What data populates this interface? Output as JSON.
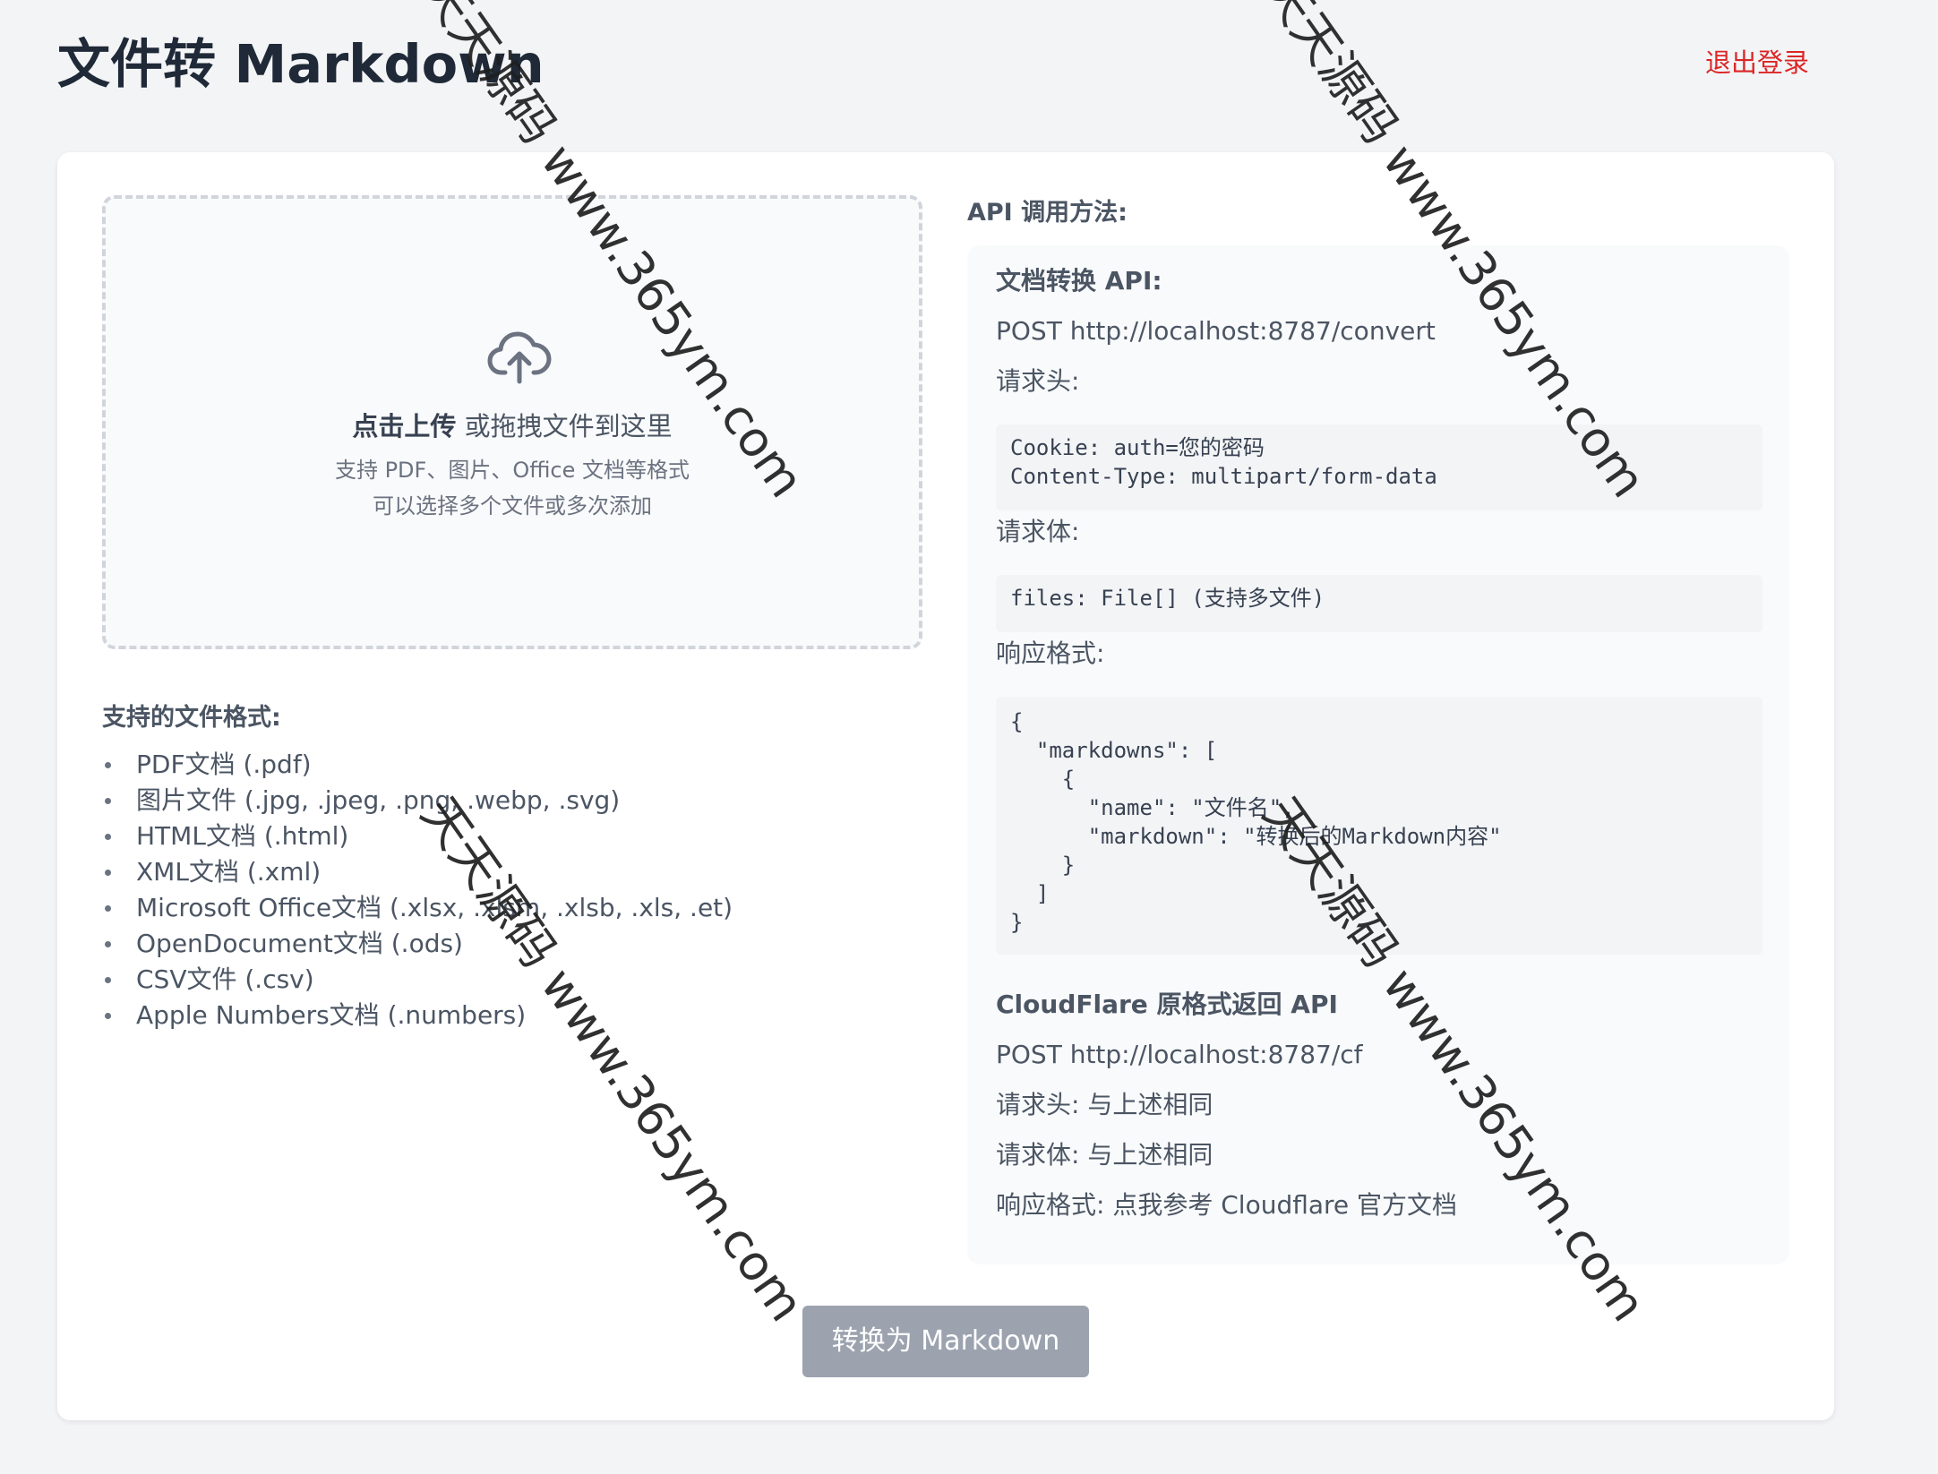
{
  "header": {
    "title": "文件转 Markdown",
    "logout_label": "退出登录"
  },
  "upload": {
    "title_strong": "点击上传",
    "title_rest": " 或拖拽文件到这里",
    "hint_formats": "支持 PDF、图片、Office 文档等格式",
    "hint_multi": "可以选择多个文件或多次添加"
  },
  "formats": {
    "title": "支持的文件格式:",
    "items": [
      "PDF文档 (.pdf)",
      "图片文件 (.jpg, .jpeg, .png, .webp, .svg)",
      "HTML文档 (.html)",
      "XML文档 (.xml)",
      "Microsoft Office文档 (.xlsx, .xlsm, .xlsb, .xls, .et)",
      "OpenDocument文档 (.ods)",
      "CSV文件 (.csv)",
      "Apple Numbers文档 (.numbers)"
    ]
  },
  "api": {
    "heading": "API 调用方法:",
    "convert_title": "文档转换 API:",
    "convert_endpoint": "POST http://localhost:8787/convert",
    "headers_label": "请求头:",
    "headers_code": "Cookie: auth=您的密码\nContent-Type: multipart/form-data",
    "body_label": "请求体:",
    "body_code": "files: File[] (支持多文件)",
    "response_label": "响应格式:",
    "response_code": "{\n  \"markdowns\": [\n    {\n      \"name\": \"文件名\",\n      \"markdown\": \"转换后的Markdown内容\"\n    }\n  ]\n}",
    "cf_title": "CloudFlare 原格式返回 API",
    "cf_endpoint": "POST http://localhost:8787/cf",
    "cf_headers": "请求头: 与上述相同",
    "cf_body": "请求体: 与上述相同",
    "cf_response_label": "响应格式: ",
    "cf_response_link": "点我参考 Cloudflare 官方文档"
  },
  "actions": {
    "convert_label": "转换为 Markdown"
  },
  "watermark": {
    "text": "天天源码 www.365ym.com"
  },
  "colors": {
    "background": "#f3f4f6",
    "logout": "#dc2626",
    "button_disabled": "#9ca3af"
  }
}
